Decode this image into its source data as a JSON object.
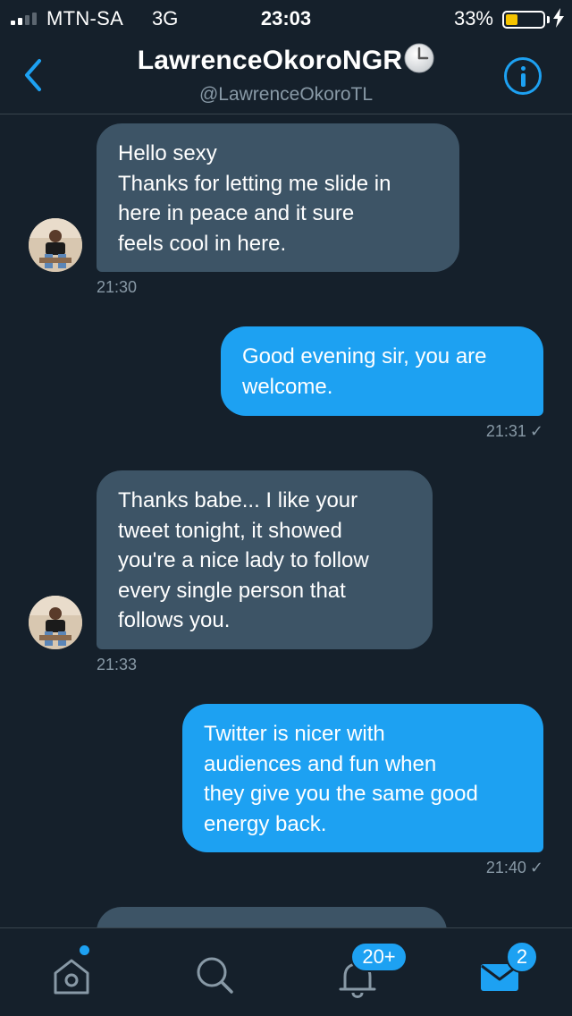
{
  "status_bar": {
    "carrier": "MTN-SA",
    "network": "3G",
    "time": "23:03",
    "battery_percent": "33%",
    "battery_level": 0.33,
    "signal_bars_filled": 2,
    "signal_bars_total": 4,
    "charging_icon": "charging-bolt-icon"
  },
  "header": {
    "back_icon": "chevron-left-icon",
    "title": "LawrenceOkoroNGR",
    "title_emoji": "clock-emoji-icon",
    "handle": "@LawrenceOkoroTL",
    "info_icon": "info-icon"
  },
  "messages": [
    {
      "direction": "in",
      "lines": [
        "Hello sexy",
        "Thanks for letting me slide in",
        "here in peace and it sure",
        "feels cool in here."
      ],
      "time": "21:30"
    },
    {
      "direction": "out",
      "lines": [
        "Good evening sir, you are",
        "welcome."
      ],
      "time": "21:31",
      "status": "✓"
    },
    {
      "direction": "in",
      "lines": [
        "Thanks babe... I like your",
        "tweet tonight, it showed",
        "you're a nice lady to follow",
        "every single person that",
        "follows you."
      ],
      "time": "21:33"
    },
    {
      "direction": "out",
      "lines": [
        "Twitter is nicer with",
        "audiences and fun when",
        "they give you the same good",
        "energy back."
      ],
      "time": "21:40",
      "status": "✓"
    }
  ],
  "tab_bar": {
    "home_icon": "home-icon",
    "search_icon": "search-icon",
    "notifications_icon": "bell-icon",
    "notifications_badge": "20+",
    "messages_icon": "envelope-icon",
    "messages_badge": "2"
  },
  "colors": {
    "background": "#15202b",
    "incoming_bubble": "#3d5466",
    "outgoing_bubble": "#1da1f2",
    "accent": "#1da1f2",
    "muted_text": "#8899a6",
    "battery": "#f5c400"
  }
}
